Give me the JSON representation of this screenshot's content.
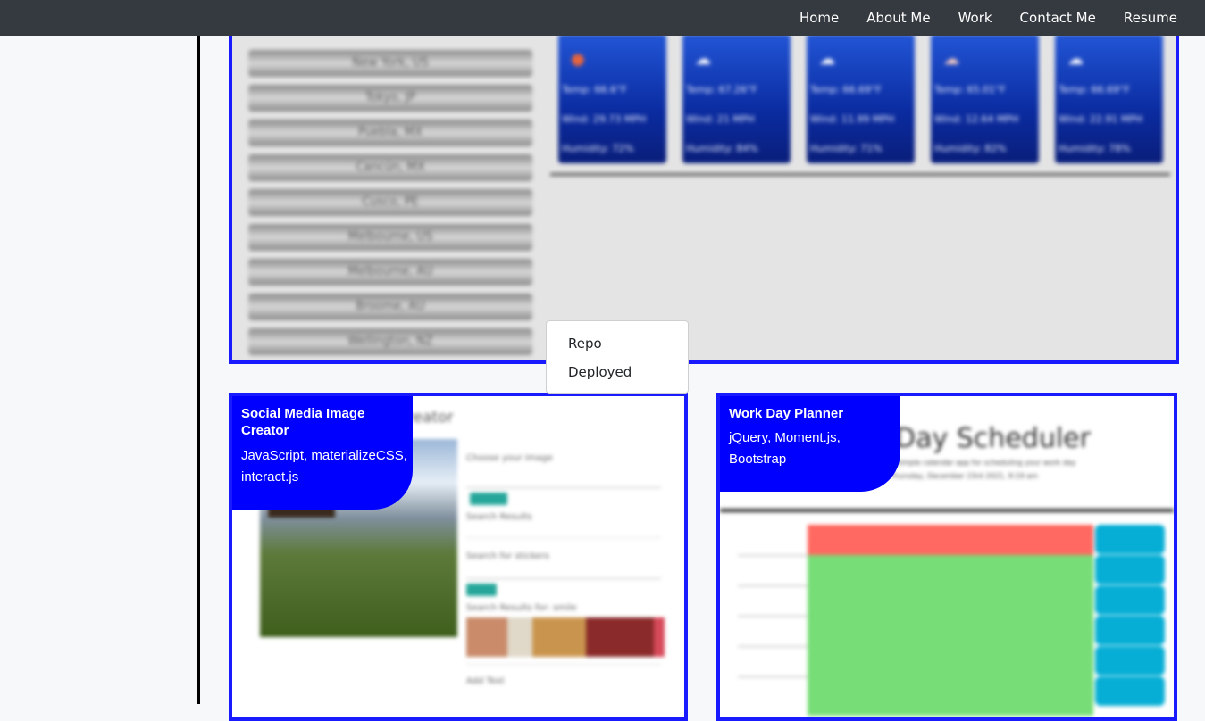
{
  "nav": {
    "links": [
      "Home",
      "About Me",
      "Work",
      "Contact Me",
      "Resume"
    ]
  },
  "weather_app": {
    "cities": [
      "New York, US",
      "Tokyo, JP",
      "Puebla, MX",
      "Cancún, MX",
      "Cusco, PE",
      "Melbourne, US",
      "Melbourne, AU",
      "Broome, AU",
      "Wellington, NZ"
    ],
    "forecast": [
      {
        "icon": "sun-icon",
        "temp": "Temp: 66.6°F",
        "wind": "Wind: 29.73 MPH",
        "humidity": "Humidity: 72%"
      },
      {
        "icon": "cloud-icon",
        "temp": "Temp: 67.26°F",
        "wind": "Wind: 21 MPH",
        "humidity": "Humidity: 84%"
      },
      {
        "icon": "cloud-icon",
        "temp": "Temp: 66.69°F",
        "wind": "Wind: 11.99 MPH",
        "humidity": "Humidity: 71%"
      },
      {
        "icon": "partly-cloudy-icon",
        "temp": "Temp: 65.01°F",
        "wind": "Wind: 12.64 MPH",
        "humidity": "Humidity: 82%"
      },
      {
        "icon": "cloud-icon",
        "temp": "Temp: 66.69°F",
        "wind": "Wind: 22.91 MPH",
        "humidity": "Humidity: 78%"
      }
    ]
  },
  "dropdown": {
    "items": [
      "Repo",
      "Deployed"
    ]
  },
  "projects": [
    {
      "title_line1": "Social Media Image",
      "title_line2": "Creator",
      "tech_line1": "JavaScript, materializeCSS,",
      "tech_line2": "interact.js",
      "screenshot": {
        "heading_fragment": "reator",
        "choose_label": "Choose your image",
        "search_results": "Search Results",
        "stickers_label": "Search for stickers",
        "stickers_results": "Search Results for: smile",
        "add_text": "Add Text"
      }
    },
    {
      "title": "Work Day Planner",
      "tech_line1": "jQuery, Moment.js,",
      "tech_line2": "Bootstrap",
      "screenshot": {
        "heading_fragment": "Day Scheduler",
        "subtitle": "A simple calendar app for scheduling your work day",
        "date": "Thursday, December 23rd 2021, 9:19 am"
      }
    }
  ],
  "colors": {
    "navbar": "#353a40",
    "accent_blue": "#0000ff",
    "planner_past": "#ff6961",
    "planner_future": "#77dd77",
    "save_btn": "#06aed5"
  }
}
